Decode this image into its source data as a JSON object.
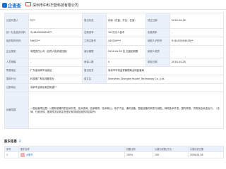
{
  "header": {
    "logo_text": "企查查",
    "company_name": "深圳市中科华智科技有限公司"
  },
  "info": {
    "legal_rep_label": "法定代表人",
    "legal_rep": "叶**",
    "status_label": "登记状态",
    "status": "存续（在营、开业、在册）",
    "established_label": "成立日期",
    "established": "2016-04-28",
    "credit_code_label": "统一社会信用代码",
    "credit_code": "91440300MA5D**",
    "registered_capital_label": "注册资本",
    "registered_capital": "100万元人民币",
    "paid_capital_label": "实缴资本",
    "paid_capital": "-",
    "org_code_label": "组织机构代码",
    "org_code": "MA5D**",
    "reg_number_label": "工商注册号",
    "reg_number": "440300***",
    "tax_id_label": "纳税人识别号",
    "tax_id": "91440300MA5D**",
    "company_type_label": "企业类型",
    "company_type": "有限责任公司（自然人投资或控股）",
    "business_term_label": "营业期限",
    "business_term": "2016-04-28 至 无固定期限",
    "taxpayer_qual_label": "纳税人资质",
    "taxpayer_qual": "-",
    "staff_label": "人员规模",
    "staff": "-",
    "insured_label": "参保人数",
    "insured": "0",
    "approval_date_label": "核准日期",
    "approval_date": "2016-04-28",
    "region_label": "所属地区",
    "region": "广东省深圳市龙岗区",
    "authority_label": "登记机关",
    "authority": "深圳市市场监督管理局龙岗监管局",
    "industry_label": "国标行业",
    "industry": "科技推广和应用服务业",
    "english_name_label": "英文名",
    "english_name": "Shenzhen Zhongke Huazhi Technology Co., Ltd.",
    "address_label": "注册地址",
    "address": "深圳市龙岗区坂田街道**",
    "scope_label": "经营范围",
    "scope": "一般经营项目是：计算机软硬件的技术开发、技术咨询、技术服务、技术转让；电子产品、通讯设备、智能设备的研发与销售；网络技术开发；国内贸易；货物及技术进出口。（法律、行政法规、国务院决定规定在登记前须经批准的项目除外）"
  },
  "shareholders": {
    "section_title": "股东信息",
    "count": "2",
    "headers": [
      "序号",
      "股东名称",
      "持股比例",
      "认缴出资额(万元)",
      "认缴出资日期"
    ],
    "rows": [
      {
        "index": "1",
        "name": "大股东",
        "ratio": "100%",
        "amount": "100",
        "date": "2036-04-28"
      }
    ]
  }
}
